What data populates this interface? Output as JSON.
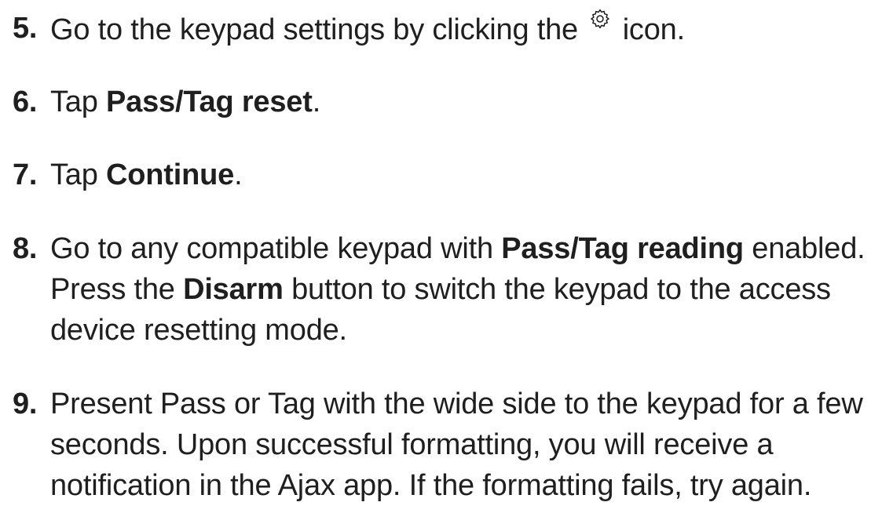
{
  "steps": [
    {
      "number": "5.",
      "parts": [
        "Go to the keypad settings by clicking the",
        "icon."
      ],
      "icon": "gear-icon"
    },
    {
      "number": "6.",
      "parts": [
        "Tap ",
        "Pass/Tag reset",
        "."
      ]
    },
    {
      "number": "7.",
      "parts": [
        "Tap ",
        "Continue",
        "."
      ]
    },
    {
      "number": "8.",
      "lines": [
        [
          "Go to any compatible keypad with ",
          "Pass/Tag reading",
          " enabled."
        ],
        [
          "Press the ",
          "Disarm",
          " button to switch the keypad to the access"
        ],
        [
          "device resetting mode."
        ]
      ]
    },
    {
      "number": "9.",
      "lines": [
        "Present Pass or Tag with the wide side to the keypad for a few",
        "seconds. Upon successful formatting, you will receive a",
        "notification in the Ajax app. If the formatting fails, try again."
      ]
    }
  ]
}
